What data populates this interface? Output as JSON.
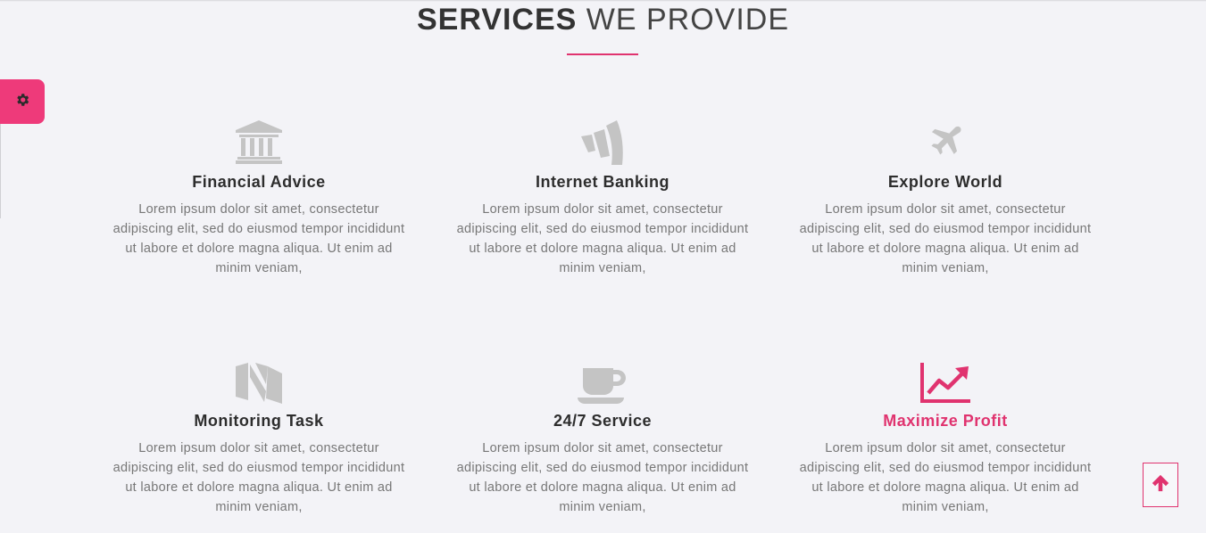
{
  "section": {
    "title_bold": "SERVICES",
    "title_light": "WE PROVIDE"
  },
  "colors": {
    "accent": "#e0336f",
    "icon_gray": "#c4c4c4",
    "background": "#f3f3f7"
  },
  "services": [
    {
      "icon": "bank-icon",
      "title": "Financial Advice",
      "desc": "Lorem ipsum dolor sit amet, consectetur adipiscing elit, sed do eiusmod tempor incididunt ut labore et dolore magna aliqua. Ut enim ad minim veniam,"
    },
    {
      "icon": "wunderlist-icon",
      "title": "Internet Banking",
      "desc": "Lorem ipsum dolor sit amet, consectetur adipiscing elit, sed do eiusmod tempor incididunt ut labore et dolore magna aliqua. Ut enim ad minim veniam,"
    },
    {
      "icon": "plane-icon",
      "title": "Explore World",
      "desc": "Lorem ipsum dolor sit amet, consectetur adipiscing elit, sed do eiusmod tempor incididunt ut labore et dolore magna aliqua. Ut enim ad minim veniam,"
    },
    {
      "icon": "medium-icon",
      "title": "Monitoring Task",
      "desc": "Lorem ipsum dolor sit amet, consectetur adipiscing elit, sed do eiusmod tempor incididunt ut labore et dolore magna aliqua. Ut enim ad minim veniam,"
    },
    {
      "icon": "coffee-cup-icon",
      "title": "24/7 Service",
      "desc": "Lorem ipsum dolor sit amet, consectetur adipiscing elit, sed do eiusmod tempor incididunt ut labore et dolore magna aliqua. Ut enim ad minim veniam,"
    },
    {
      "icon": "line-chart-icon",
      "title": "Maximize Profit",
      "desc": "Lorem ipsum dolor sit amet, consectetur adipiscing elit, sed do eiusmod tempor incididunt ut labore et dolore magna aliqua. Ut enim ad minim veniam,"
    }
  ],
  "widgets": {
    "settings_icon": "gear-icon",
    "back_to_top_icon": "arrow-up-icon"
  }
}
